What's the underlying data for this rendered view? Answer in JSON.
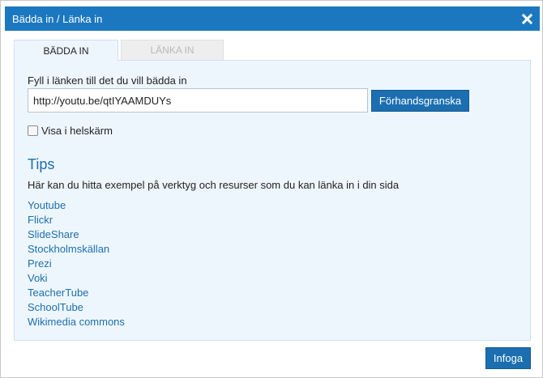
{
  "dialog": {
    "title": "Bädda in / Länka in",
    "close_icon": "close-icon"
  },
  "tabs": [
    {
      "label": "BÄDDA IN",
      "active": true
    },
    {
      "label": "LÄNKA IN",
      "active": false
    }
  ],
  "embed": {
    "field_label": "Fyll i länken till det du vill bädda in",
    "url_value": "http://youtu.be/qtIYAAMDUYs",
    "preview_label": "Förhandsgranska",
    "fullscreen_label": "Visa i helskärm",
    "fullscreen_checked": false
  },
  "tips": {
    "title": "Tips",
    "description": "Här kan du hitta exempel på verktyg och resurser som du kan länka in i din sida",
    "links": [
      "Youtube",
      "Flickr",
      "SlideShare",
      "Stockholmskällan",
      "Prezi",
      "Voki",
      "TeacherTube",
      "SchoolTube",
      "Wikimedia commons"
    ]
  },
  "footer": {
    "insert_label": "Infoga"
  },
  "colors": {
    "accent": "#1b78c0",
    "button": "#1b6fb0",
    "panel_bg": "#eef6fd"
  }
}
